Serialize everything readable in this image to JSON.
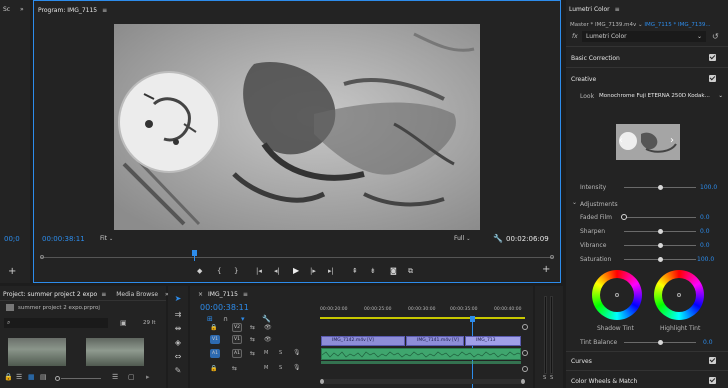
{
  "left_strip": {
    "tab_label": "Sc",
    "expand": "»",
    "timecode": "00;0"
  },
  "program_monitor": {
    "title": "Program: IMG_7115",
    "menu_icon": "≡",
    "timecode_current": "00:00:38:11",
    "zoom": "Fit",
    "resolution": "Full",
    "timecode_duration": "00:02:06:09",
    "transport_icons": [
      "marker-icon",
      "in-point-icon",
      "out-point-icon",
      "go-to-in-icon",
      "step-back-icon",
      "play-icon",
      "step-forward-icon",
      "go-to-out-icon",
      "lift-icon",
      "extract-icon",
      "export-frame-icon",
      "settings-icon"
    ]
  },
  "lumetri": {
    "title": "Lumetri Color",
    "menu_icon": "≡",
    "master_label": "Master * IMG_7139.m4v",
    "clip_label": "IMG_7115 * IMG_7139...",
    "fx_label": "fx",
    "fx_name": "Lumetri Color",
    "sections": {
      "basic_correction": "Basic Correction",
      "creative": "Creative",
      "curves": "Curves",
      "color_wheels": "Color Wheels & Match"
    },
    "look_label": "Look",
    "look_value": "Monochrome Fuji ETERNA 250D Kodak...",
    "intensity_label": "Intensity",
    "intensity_value": "100.0",
    "adjustments_label": "Adjustments",
    "adjustments": [
      {
        "label": "Faded Film",
        "value": "0.0",
        "level": 0.0
      },
      {
        "label": "Sharpen",
        "value": "0.0",
        "level": 0.5
      },
      {
        "label": "Vibrance",
        "value": "0.0",
        "level": 0.5
      },
      {
        "label": "Saturation",
        "value": "100.0",
        "level": 0.5
      }
    ],
    "shadow_tint_label": "Shadow Tint",
    "highlight_tint_label": "Highlight Tint",
    "tint_balance_label": "Tint Balance",
    "tint_balance_value": "0.0"
  },
  "project": {
    "tab_label": "Project: summer project 2 expo",
    "media_browser_label": "Media Browse",
    "expand": "»",
    "file_name": "summer project 2 expo.prproj",
    "items_count": "29 It"
  },
  "timeline": {
    "tab_label": "IMG_7115",
    "timecode": "00:00:38:11",
    "ruler_labels": [
      "00:00:20:00",
      "00:00:25:00",
      "00:00:30:00",
      "00:00:35:00",
      "00:00:40:00",
      "00:00:45:00"
    ],
    "tracks": [
      {
        "name": "V2",
        "kind": "video"
      },
      {
        "name": "V1",
        "kind": "video",
        "target": "V1"
      },
      {
        "name": "A1",
        "kind": "audio",
        "target": "A1"
      }
    ],
    "clips": [
      {
        "label": "IMG_7142.m4v [V]"
      },
      {
        "label": "IMG_7141.m4v [V]"
      },
      {
        "label": "IMG_713"
      }
    ]
  },
  "meter": {
    "labels": [
      "S",
      "S"
    ]
  },
  "colors": {
    "accent": "#2d8ceb",
    "background": "#1d1d1d",
    "panel": "#232323",
    "clip_video": "#8e8ed8",
    "clip_audio": "#3fa66e",
    "playhead": "#2d8ceb"
  }
}
